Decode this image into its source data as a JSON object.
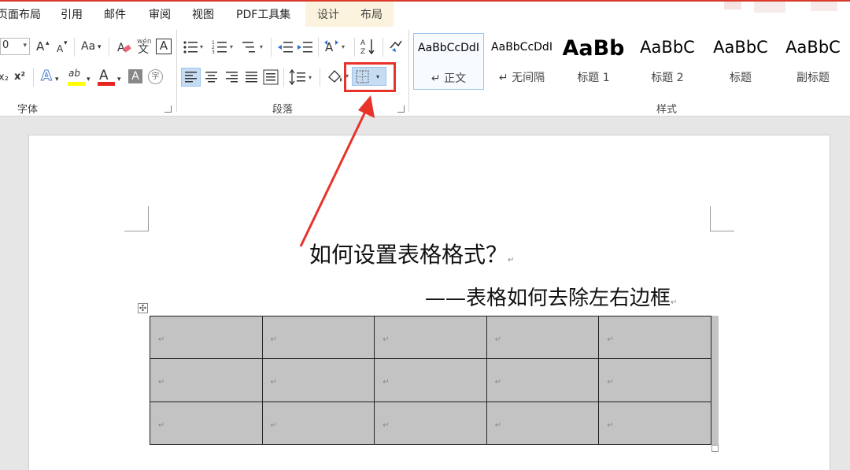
{
  "tabs": [
    {
      "label": "页面布局",
      "display": "页面布局"
    },
    {
      "label": "引用"
    },
    {
      "label": "邮件"
    },
    {
      "label": "审阅"
    },
    {
      "label": "视图"
    },
    {
      "label": "PDF工具集"
    },
    {
      "label": "设计"
    },
    {
      "label": "布局"
    }
  ],
  "font_group": {
    "label": "字体",
    "font_size_value": "0",
    "grow_label": "A",
    "shrink_label": "A",
    "change_case_label": "Aa",
    "phonetic_top": "wén",
    "phonetic_char": "文",
    "char_border_label": "A",
    "subscript_label": "x₂",
    "superscript_label": "x²",
    "text_effect_label": "A",
    "highlight_label": "ab",
    "font_color_label": "A",
    "char_shading_label": "A",
    "enclose_label": "字"
  },
  "paragraph_group": {
    "label": "段落"
  },
  "styles_group": {
    "label": "样式",
    "items": [
      {
        "sample": "AaBbCcDdI",
        "name": "↵ 正文"
      },
      {
        "sample": "AaBbCcDdI",
        "name": "↵ 无间隔"
      },
      {
        "sample": "AaBb",
        "name": "标题 1"
      },
      {
        "sample": "AaBbC",
        "name": "标题 2"
      },
      {
        "sample": "AaBbC",
        "name": "标题"
      },
      {
        "sample": "AaBbC",
        "name": "副标题"
      }
    ]
  },
  "document": {
    "title": "如何设置表格格式？",
    "subtitle": "——表格如何去除左右边框",
    "paragraph_mark": "↵",
    "table": {
      "rows": 3,
      "cols": 5,
      "cell_mark": "↵"
    }
  },
  "colors": {
    "accent_red": "#e8332b",
    "tab_border": "#d83a2c",
    "cell_shading": "#c3c3c3",
    "highlight_yellow": "#ffff00",
    "font_color_red": "#e52620"
  }
}
